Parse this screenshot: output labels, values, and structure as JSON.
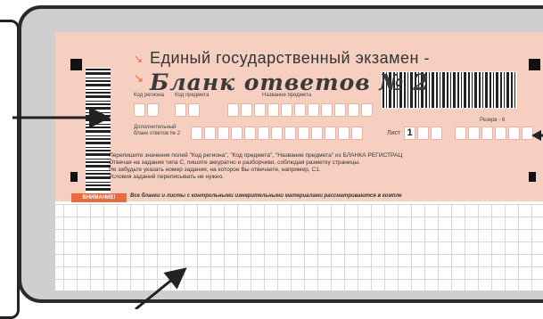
{
  "form": {
    "ege_title": "Единый государственный экзамен -",
    "ege_arrow": "↘",
    "title_arrow": "↘",
    "blank_title": "Бланк ответов № 2",
    "region_code_label": "Код региона",
    "subject_code_label": "Код предмета",
    "subject_name_label": "Название предмета",
    "additional_sheet_label": "Дополнительный бланк ответов № 2",
    "sheet_label": "Лист",
    "sheet_value": "1",
    "reserve_label": "Резерв - 6"
  },
  "instructions": [
    "Перепишите значения полей \"Код региона\", \"Код предмета\", \"Название предмета\" из БЛАНКА РЕГИСТРАЦ",
    "Отвечая на задания типа С, пишите аккуратно и разборчиво, соблюдая разметку страницы.",
    "Не забудьте указать номер задания, на которое Вы отвечаете, например, С1.",
    "Условия заданий переписывать не нужно."
  ],
  "warning": {
    "badge": "ВНИМАНИЕ!",
    "text": "Все бланки и листы с контрольными измерительными материалами рассматриваются в компле"
  },
  "colors": {
    "header_bg": "#f6cfc0",
    "accent": "#ea6a3e",
    "frame": "#cfcfcf",
    "grid_line": "#dad6d2"
  }
}
